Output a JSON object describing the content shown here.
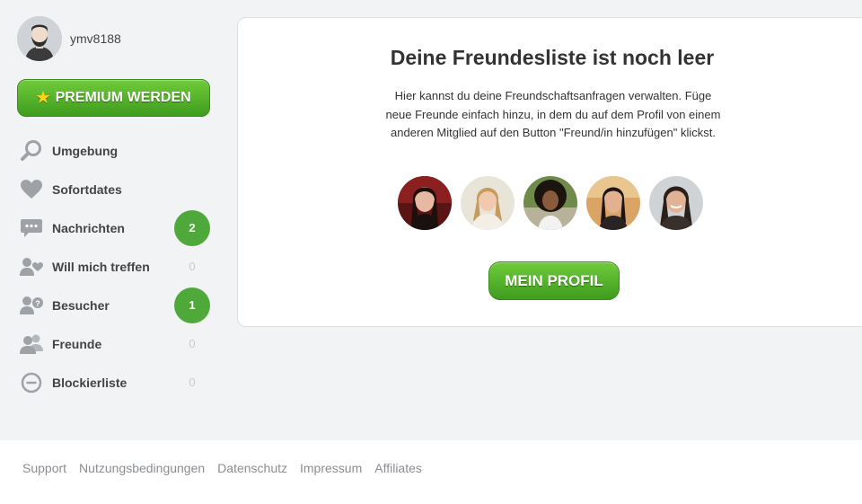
{
  "user": {
    "username": "ymv8188",
    "avatar_icon": "default-male-avatar-icon"
  },
  "premium": {
    "label": "PREMIUM WERDEN",
    "icon": "star-icon"
  },
  "nav": {
    "items": [
      {
        "label": "Umgebung",
        "icon": "search-icon",
        "count": ""
      },
      {
        "label": "Sofortdates",
        "icon": "heart-icon",
        "count": ""
      },
      {
        "label": "Nachrichten",
        "icon": "chat-icon",
        "count": "2",
        "highlight": true
      },
      {
        "label": "Will mich treffen",
        "icon": "user-heart-icon",
        "count": "0"
      },
      {
        "label": "Besucher",
        "icon": "user-question-icon",
        "count": "1",
        "highlight": true
      },
      {
        "label": "Freunde",
        "icon": "users-icon",
        "count": "0"
      },
      {
        "label": "Blockierliste",
        "icon": "block-icon",
        "count": "0"
      }
    ]
  },
  "main": {
    "title": "Deine Freundesliste ist noch leer",
    "text": "Hier kannst du deine Freundschaftsanfragen verwalten. Füge neue Freunde einfach hinzu, in dem du auf dem Profil von einem anderen Mitglied auf den Button \"Freund/in hinzufügen\" klickst.",
    "button_label": "MEIN PROFIL"
  },
  "footer": {
    "links": [
      "Support",
      "Nutzungsbedingungen",
      "Datenschutz",
      "Impressum",
      "Affiliates"
    ]
  },
  "colors": {
    "accent_green": "#4fa83a",
    "star_yellow": "#ffd21a",
    "background": "#f2f3f5"
  }
}
